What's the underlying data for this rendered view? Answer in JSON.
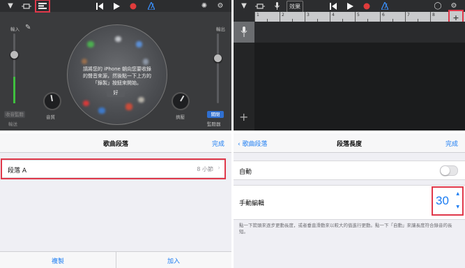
{
  "colors": {
    "highlight": "#e0384a",
    "ios_blue": "#1b7cf2",
    "level_green": "#3fbf3f",
    "record_red": "#e03b3b"
  },
  "top_left": {
    "input_label": "輸入",
    "output_label": "輸出",
    "message": "請將您的 iPhone 朝向您要收錄的聲音來源，然後點一下上方的「錄製」按鈕來開始。",
    "ok_button": "好",
    "tone_label": "音質",
    "compressor_label": "擠壓",
    "left_small_label": "收音監聽",
    "left_small_sub": "輸送",
    "monitor_button": "關閉",
    "monitor_label": "監聽器",
    "icons": [
      "triangle-down-icon",
      "loop-icon",
      "tracks-view-icon",
      "rewind-icon",
      "play-icon",
      "record-icon",
      "metronome-icon",
      "settings-icon",
      "tune-icon"
    ]
  },
  "top_right": {
    "effects_button": "效果",
    "ruler_numbers": [
      "1",
      "2",
      "3",
      "4",
      "5",
      "6",
      "7",
      "8"
    ],
    "icons": [
      "triangle-down-icon",
      "loop-icon",
      "mic-icon",
      "rewind-icon",
      "play-icon",
      "record-icon",
      "metronome-icon",
      "loop-browser-icon",
      "settings-icon",
      "add-section-icon",
      "add-track-icon"
    ]
  },
  "song_sections": {
    "title": "歌曲段落",
    "done": "完成",
    "section_name": "段落 A",
    "section_length": "8 小節",
    "duplicate_button": "複製",
    "add_button": "加入"
  },
  "section_length": {
    "back": "歌曲段落",
    "title": "段落長度",
    "done": "完成",
    "auto_label": "自動",
    "auto_enabled": false,
    "manual_label": "手動編輯",
    "manual_value": "30",
    "help_text": "點一下箭頭來逐步更動長度，或者垂直滑動來以較大的值進行更動。點一下「自動」來讓長度符合錄音的長短。"
  }
}
